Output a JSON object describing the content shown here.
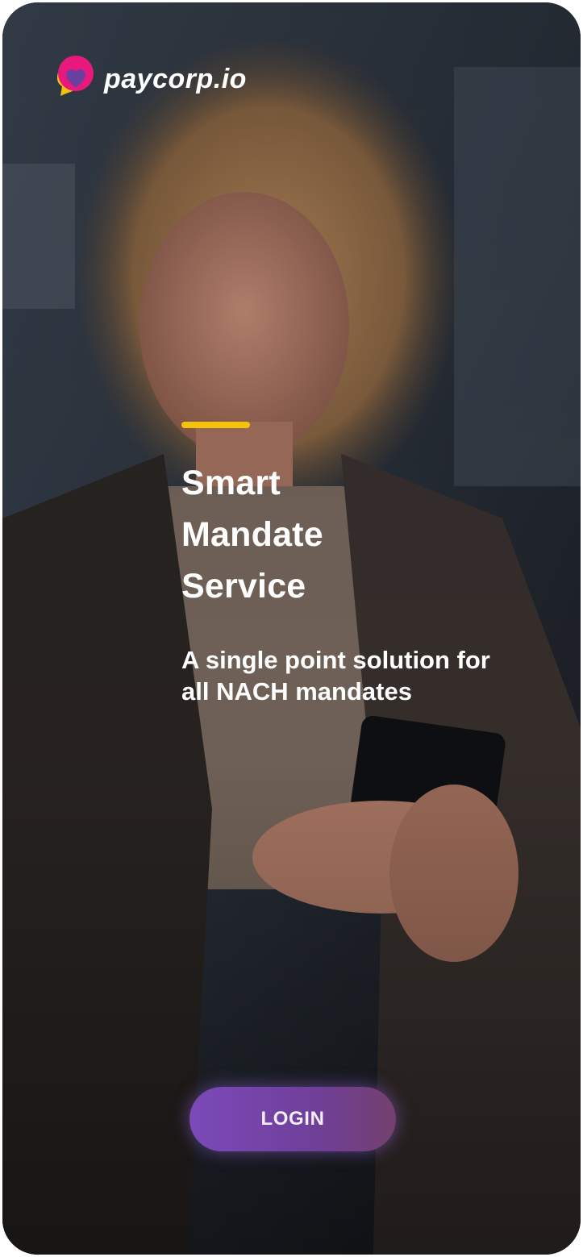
{
  "brand": {
    "name": "paycorp.io",
    "colors": {
      "pink": "#e8197d",
      "purple": "#6b3fa0",
      "yellow": "#f5c20b"
    }
  },
  "hero": {
    "headline_lines": [
      "Smart",
      "Mandate",
      "Service"
    ],
    "subline_lines": [
      "A single point solution for",
      "all NACH mandates"
    ],
    "accent_color": "#f5c20b"
  },
  "actions": {
    "login_label": "LOGIN"
  },
  "background": {
    "icon": "photo-woman-using-phone"
  }
}
